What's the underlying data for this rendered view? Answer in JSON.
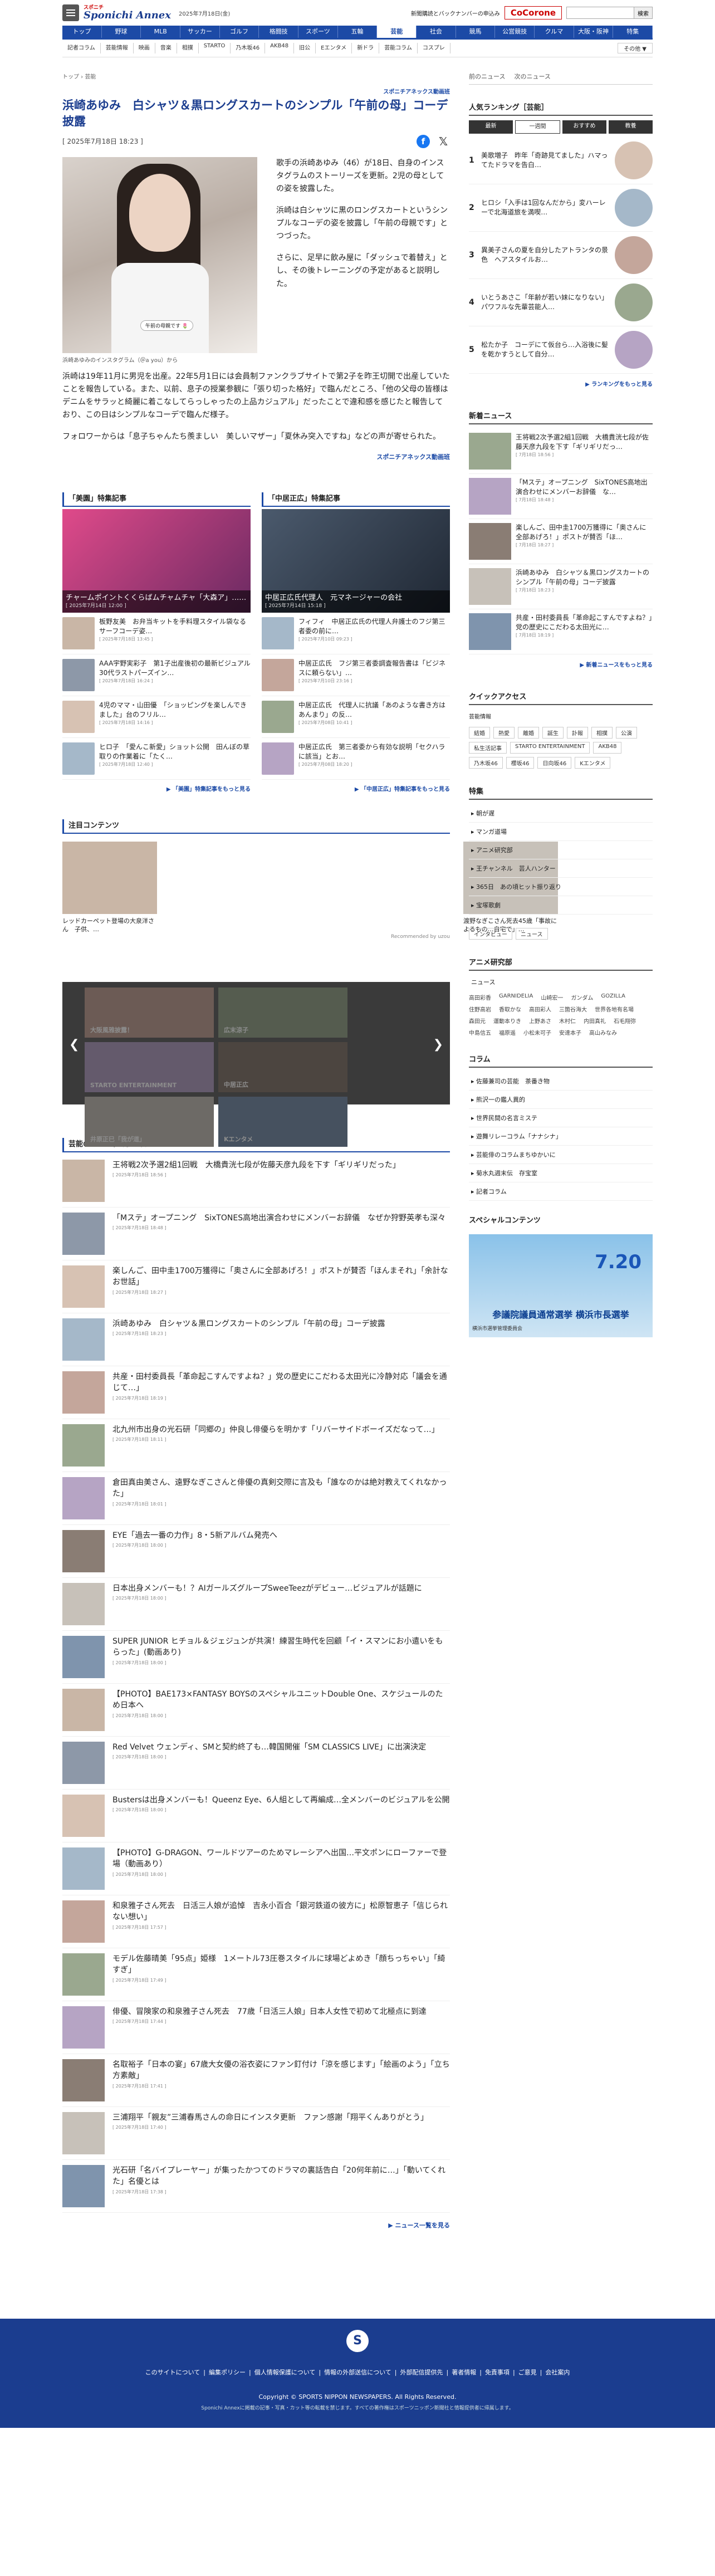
{
  "header": {
    "logo": "Sponichi Annex",
    "logo_tag": "スポニチ",
    "date": "2025年7月18日(金)",
    "backnumber": "新聞購読とバックナンバーの申込み",
    "cocorone": "CoCorone",
    "search_placeholder": "",
    "search_button": "検索"
  },
  "nav": [
    "トップ",
    "野球",
    "MLB",
    "サッカー",
    "ゴルフ",
    "格闘技",
    "スポーツ",
    "五輪",
    "芸能",
    "社会",
    "競馬",
    "公営競技",
    "クルマ",
    "大阪・阪神",
    "特集"
  ],
  "nav_active": "芸能",
  "subnav": [
    "記者コラム",
    "芸能情報",
    "映画",
    "音楽",
    "相撲",
    "STARTO",
    "乃木坂46",
    "AKB48",
    "旧公",
    "Eエンタメ",
    "新ドラ",
    "芸能コラム",
    "コスプレ"
  ],
  "subnav_more": "その他 ▼",
  "breadcrumb": [
    "トップ",
    "芸能"
  ],
  "side_tabs": [
    "前のニュース",
    "次のニュース"
  ],
  "article": {
    "kicker": "スポニチアネックス動画班",
    "title": "浜崎あゆみ　白シャツ＆黒ロングスカートのシンプル「午前の母」コーデ披露",
    "date": "[ 2025年7月18日 18:23 ]",
    "caption": "浜崎あゆみのインスタグラム（＠a you）から",
    "photo_tag": "午前の母親です 🌷",
    "p1": "歌手の浜崎あゆみ（46）が18日、自身のインスタグラムのストーリーズを更新。2児の母としての姿を披露した。",
    "p2": "浜崎は白シャツに黒のロングスカートというシンプルなコーデの姿を披露し「午前の母親です」とつづった。",
    "p3": "さらに、足早に飲み屋に「ダッシュで着替え」とし、その後トレーニングの予定があると説明した。",
    "p4": "浜崎は19年11月に男児を出産。22年5月1日には会員制ファンクラブサイトで第2子を昨王切開で出産していたことを報告している。また、以前、息子の授業参観に「張り切った格好」で臨んだところ、「他の父母の皆様はデニムをサラッと綺麗に着こなしてらっしゃったの上品カジュアル」だったことで違和感を感じたと報告しており、この日はシンプルなコーデで臨んだ様子。",
    "p5": "フォロワーからは「息子ちゃんたち羨ましい　美しいマザー」「夏休み突入ですね」などの声が寄せられた。",
    "more": "スポニチアネックス動画班"
  },
  "features": [
    {
      "title": "「美園」特集記事",
      "hero": "チャームポイントくくらばムチャムチャ「大森ア」……",
      "hero_date": "[ 2025年7月14日 12:00 ]",
      "items": [
        {
          "t": "板野友美　お弁当キットを手料理スタイル袋なるサーフコーデ姿…",
          "d": "[ 2025年7月18日 13:45 ]"
        },
        {
          "t": "AAA宇野実彩子　第1子出産後初の最新ビジュアル　30代ラストパーズイン…",
          "d": "[ 2025年7月18日 16:24 ]"
        },
        {
          "t": "4児のママ・山田優　「ショッピングを楽しんできました」台のフリル…",
          "d": "[ 2025年7月18日 14:16 ]"
        },
        {
          "t": "ヒロ子　「愛んこ新愛」ショット公開　田んぼの草取りの作業着に「たく…",
          "d": "[ 2025年7月18日 12:40 ]"
        }
      ],
      "more": "「美園」特集記事をもっと見る"
    },
    {
      "title": "「中居正広」特集記事",
      "hero": "中居正広氏代理人　元マネージャーの会社",
      "hero_date": "[ 2025年7月14日 15:18 ]",
      "items": [
        {
          "t": "フィフィ　中居正広氏の代理人弁護士のフジ第三者委の前に…",
          "d": "[ 2025年7月10日 09:23 ]"
        },
        {
          "t": "中居正広氏　フジ第三者委調査報告書は「ビジネスに頼らない」…",
          "d": "[ 2025年7月10日 23:16 ]"
        },
        {
          "t": "中居正広氏　代理人に抗議「あのような書き方はあんまり」の反…",
          "d": "[ 2025年7月08日 10:41 ]"
        },
        {
          "t": "中居正広氏　第三者委から有効な説明「セクハラに該当」とお…",
          "d": "[ 2025年7月08日 18:20 ]"
        }
      ],
      "more": "「中居正広」特集記事をもっと見る"
    }
  ],
  "attention": {
    "title": "注目コンテンツ",
    "items": [
      "レッドカーペット登場の大泉洋さん　子供、…",
      "",
      "",
      "",
      "渡野なぎこさん死去45歳「事故によるもの…自宅で」…"
    ],
    "credit": "Recommended by uzou"
  },
  "carousel": [
    "大阪風雅披露！",
    "広末涼子",
    "STARTO ENTERTAINMENT",
    "中居正広",
    "井原正巳「我が道」",
    "Kエンタメ"
  ],
  "news": {
    "title": "芸能の2025年7月18日のニュース",
    "items": [
      {
        "t": "王将戦2次予選2組1回戦　大橋貴洸七段が佐藤天彦九段を下す「ギリギリだった」",
        "d": "[ 2025年7月18日 18:56 ]"
      },
      {
        "t": "「Mステ」オープニング　SixTONES高地出演合わせにメンバーお辞儀　なぜか狩野英孝も深々",
        "d": "[ 2025年7月18日 18:48 ]"
      },
      {
        "t": "楽しんご、田中圭1700万獲得に「奥さんに全部あげろ！」ポストが賛否「ほんまそれ」「余計なお世話」",
        "d": "[ 2025年7月18日 18:27 ]"
      },
      {
        "t": "浜崎あゆみ　白シャツ＆黒ロングスカートのシンプル「午前の母」コーデ披露",
        "d": "[ 2025年7月18日 18:23 ]"
      },
      {
        "t": "共産・田村委員長「革命起こすんですよね？」党の歴史にこだわる太田光に冷静対応「議会を通じて…」",
        "d": "[ 2025年7月18日 18:19 ]"
      },
      {
        "t": "北九州市出身の光石研「同郷の」仲良し俳優らを明かす「リバーサイドボーイズだなって…」",
        "d": "[ 2025年7月18日 18:11 ]"
      },
      {
        "t": "倉田真由美さん、遠野なぎこさんと俳優の真剣交際に言及も「誰なのかは絶対教えてくれなかった」",
        "d": "[ 2025年7月18日 18:01 ]"
      },
      {
        "t": "EYE「過去一番の力作」8・5新アルバム発売へ",
        "d": "[ 2025年7月18日 18:00 ]"
      },
      {
        "t": "日本出身メンバーも！？AIガールズグループSweeTeezがデビュー…ビジュアルが話題に",
        "d": "[ 2025年7月18日 18:00 ]"
      },
      {
        "t": "SUPER JUNIOR ヒチョル＆ジェジュンが共演！練習生時代を回顧「イ・スマンにお小遣いをもらった」(動画あり)",
        "d": "[ 2025年7月18日 18:00 ]"
      },
      {
        "t": "【PHOTO】BAE173×FANTASY BOYSのスペシャルユニットDouble One、スケジュールのため日本へ",
        "d": "[ 2025年7月18日 18:00 ]"
      },
      {
        "t": "Red Velvet ウェンディ、SMと契約終了も…韓国開催「SM CLASSICS LIVE」に出演決定",
        "d": "[ 2025年7月18日 18:00 ]"
      },
      {
        "t": "Bustersは出身メンバーも！Queenz Eye、6人組として再編成…全メンバーのビジュアルを公開",
        "d": "[ 2025年7月18日 18:00 ]"
      },
      {
        "t": "【PHOTO】G-DRAGON、ワールドツアーのためマレーシアへ出国…平文ポンにローファーで登場（動画あり）",
        "d": "[ 2025年7月18日 18:00 ]"
      },
      {
        "t": "和泉雅子さん死去　日活三人娘が追悼　吉永小百合「銀河鉄道の彼方に」松原智恵子「信じられない想い」",
        "d": "[ 2025年7月18日 17:57 ]"
      },
      {
        "t": "モデル佐藤晴美「95点」姫様　1メートル73圧巻スタイルに球場どよめき「顔ちっちゃい」「綺すぎ」",
        "d": "[ 2025年7月18日 17:49 ]"
      },
      {
        "t": "俳優、冒険家の和泉雅子さん死去　77歳「日活三人娘」日本人女性で初めて北極点に到達",
        "d": "[ 2025年7月18日 17:44 ]"
      },
      {
        "t": "名取裕子「日本の宴」67歳大女優の浴衣姿にファン釘付け「涼を感じます」「絵画のよう」「立ち方素敵」",
        "d": "[ 2025年7月18日 17:41 ]"
      },
      {
        "t": "三浦翔平「親友”三浦春馬さんの命日にインスタ更新　ファン感謝「翔平くんありがとう」",
        "d": "[ 2025年7月18日 17:40 ]"
      },
      {
        "t": "光石研「名バイプレーヤー」が集ったかつてのドラマの裏話告白「20何年前に…」「動いてくれた」名優とは",
        "d": "[ 2025年7月18日 17:38 ]"
      }
    ],
    "more": "ニュース一覧を見る"
  },
  "sidebar": {
    "ranking_title": "人気ランキング［芸能］",
    "ranking_tabs": [
      "最新",
      "一週間",
      "おすすめ",
      "教養"
    ],
    "ranking_active": "一週間",
    "ranking": [
      {
        "n": "1",
        "t": "美歌増子　昨年「奇跡見てました」ハマってたドラマを告白…"
      },
      {
        "n": "2",
        "t": "ヒロシ「入手は1回なんだから」変ハーレーで北海道旅を満喫…"
      },
      {
        "n": "3",
        "t": "異美子さんの夏を自分したアトランタの景色　ヘアスタイルお…"
      },
      {
        "n": "4",
        "t": "いとうあさこ「年齢が若い妹になりない」パワフルな先輩芸能人…"
      },
      {
        "n": "5",
        "t": "松たか子　コーデにて仮台ら…入浴後に髪を乾かすうとして自分…"
      }
    ],
    "ranking_more": "ランキングをもっと見る",
    "news_title": "新着ニュース",
    "news": [
      {
        "t": "王将戦2次予選2組1回戦　大橋貴洸七段が佐藤天彦九段を下す「ギリギリだっ…",
        "d": "[ 7月18日 18:56 ]"
      },
      {
        "t": "「Mステ」オープニング　SixTONES高地出演合わせにメンバーお辞儀　な…",
        "d": "[ 7月18日 18:48 ]"
      },
      {
        "t": "楽しんご、田中圭1700万獲得に「奥さんに全部あげろ！」ポストが賛否「ほ…",
        "d": "[ 7月18日 18:27 ]"
      },
      {
        "t": "浜崎あゆみ　白シャツ＆黒ロングスカートのシンプル「午前の母」コーデ披露",
        "d": "[ 7月18日 18:23 ]"
      },
      {
        "t": "共産・田村委員長「革命起こすんですよね？」党の歴史にこだわる太田光に…",
        "d": "[ 7月18日 18:19 ]"
      }
    ],
    "news_more": "新着ニュースをもっと見る",
    "quick_title": "クイックアクセス",
    "quick_sub": "芸能情報",
    "quick_tags": [
      "結婚",
      "熱愛",
      "離婚",
      "誕生",
      "訃報",
      "相撲",
      "公演",
      "私生活記事",
      "STARTO ENTERTAINMENT",
      "AKB48",
      "乃木坂46",
      "櫻坂46",
      "日向坂46",
      "Kエンタメ"
    ],
    "special_title": "特集",
    "special": [
      "朝が遅",
      "マンガ道場",
      "アニメ研究部",
      "王チャンネル　芸人ハンター",
      "365日　あの頃ヒット振り返り",
      "宝塚歌劇"
    ],
    "special_tags": [
      "インタビュー",
      "ニュース"
    ],
    "anime_title": "アニメ研究部",
    "anime_sub": "ニュース",
    "names": [
      "高田彩香",
      "GARNIDELIA",
      "山崎宏一",
      "ガンダム",
      "GOZILLA",
      "住野高岩",
      "香取かな",
      "高田彩人",
      "三箇谷海大",
      "世界各地有名場",
      "森田元",
      "運動本りき",
      "上野あさ",
      "木村仁",
      "内田真礼",
      "石毛翔弥",
      "中島信五",
      "福原遥",
      "小松未可子",
      "安達本子",
      "高山みなみ"
    ],
    "column_title": "コラム",
    "columns": [
      "佐藤兼司の芸能　茶番き物",
      "熊沢一の鑑人異的",
      "世界民間の名言ミステ",
      "遊舞リレーコラム「ナナシナ」",
      "芸能俳のコラムまちゆかいに",
      "菊水丸週末伝　存宝室",
      "記者コラム"
    ],
    "sp_title": "スペシャルコンテンツ",
    "sp_banner": "参議院議員通常選挙 横浜市長選挙",
    "sp_date": "7.20",
    "sp_note": "横浜市選挙管理委員会"
  },
  "footer": {
    "links": [
      "このサイトについて",
      "編集ポリシー",
      "個人情報保護について",
      "情報の外部送信について",
      "外部配信提供先",
      "著者情報",
      "免責事項",
      "ご意見",
      "会社案内"
    ],
    "copyright": "Copyright © SPORTS NIPPON NEWSPAPERS. All Rights Reserved.",
    "sub": "Sponichi Annexに掲載の記事・写真・カット等の転載を禁じます。すべての著作権はスポーツニッポン新聞社と情報提供者に帰属します。"
  },
  "colors": {
    "brand": "#1b3d8f",
    "nav": "#1c4aa6",
    "accent": "#c00"
  }
}
